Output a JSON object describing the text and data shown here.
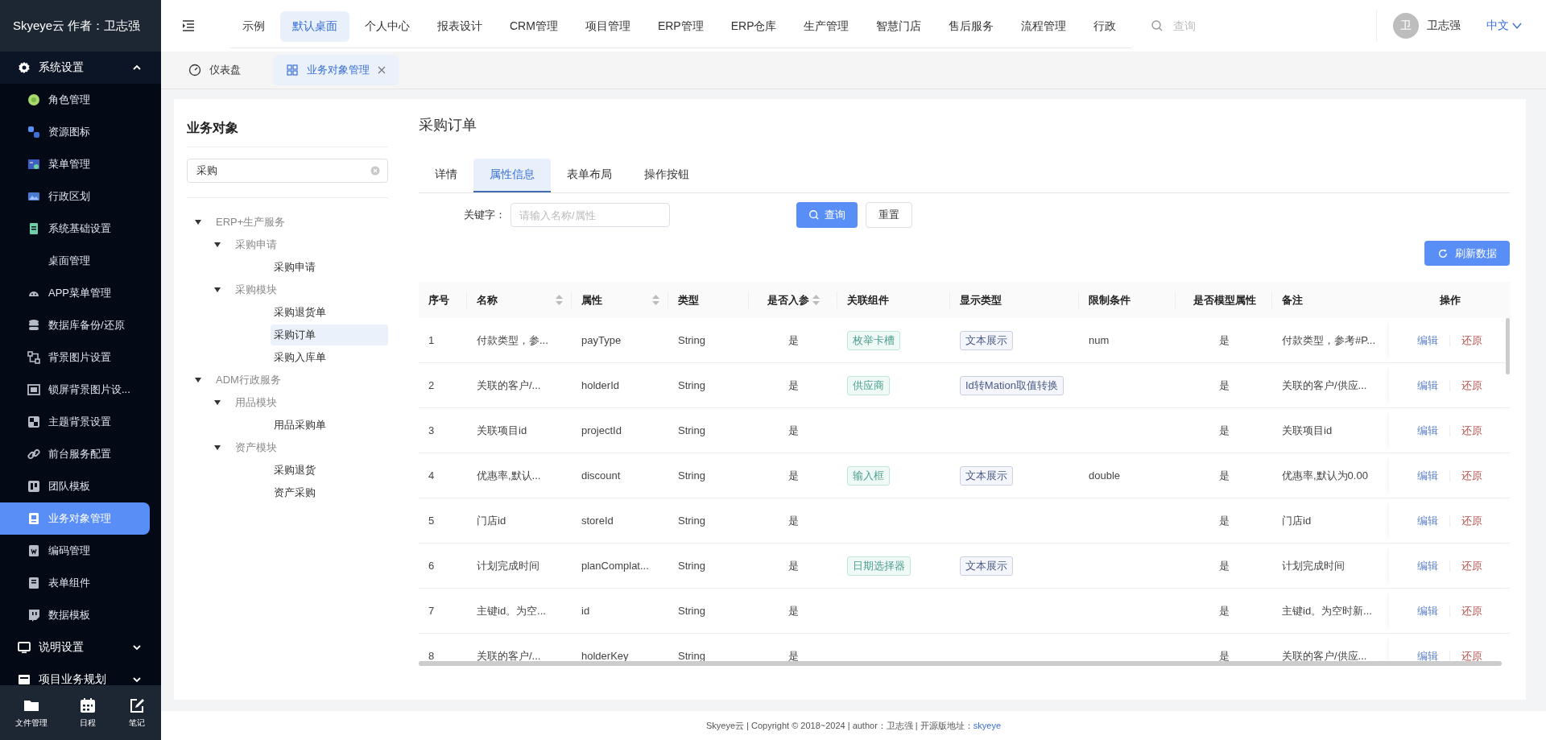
{
  "sidebar": {
    "brand": "Skyeye云 作者：卫志强",
    "groups": [
      {
        "label": "系统设置",
        "expanded": true,
        "items": [
          {
            "label": "角色管理",
            "selected": false
          },
          {
            "label": "资源图标",
            "selected": false
          },
          {
            "label": "菜单管理",
            "selected": false
          },
          {
            "label": "行政区划",
            "selected": false
          },
          {
            "label": "系统基础设置",
            "selected": false
          },
          {
            "label": "桌面管理",
            "selected": false
          },
          {
            "label": "APP菜单管理",
            "selected": false
          },
          {
            "label": "数据库备份/还原",
            "selected": false
          },
          {
            "label": "背景图片设置",
            "selected": false
          },
          {
            "label": "锁屏背景图片设...",
            "selected": false
          },
          {
            "label": "主题背景设置",
            "selected": false
          },
          {
            "label": "前台服务配置",
            "selected": false
          },
          {
            "label": "团队模板",
            "selected": false
          },
          {
            "label": "业务对象管理",
            "selected": true
          },
          {
            "label": "编码管理",
            "selected": false
          },
          {
            "label": "表单组件",
            "selected": false
          },
          {
            "label": "数据模板",
            "selected": false
          }
        ]
      },
      {
        "label": "说明设置",
        "expanded": false
      },
      {
        "label": "项目业务规划",
        "expanded": false
      }
    ],
    "dock": [
      {
        "label": "文件管理"
      },
      {
        "label": "日程"
      },
      {
        "label": "笔记"
      }
    ]
  },
  "top_nav": {
    "items": [
      {
        "label": "示例",
        "selected": false
      },
      {
        "label": "默认桌面",
        "selected": true
      },
      {
        "label": "个人中心",
        "selected": false
      },
      {
        "label": "报表设计",
        "selected": false
      },
      {
        "label": "CRM管理",
        "selected": false
      },
      {
        "label": "项目管理",
        "selected": false
      },
      {
        "label": "ERP管理",
        "selected": false
      },
      {
        "label": "ERP仓库",
        "selected": false
      },
      {
        "label": "生产管理",
        "selected": false
      },
      {
        "label": "智慧门店",
        "selected": false
      },
      {
        "label": "售后服务",
        "selected": false
      },
      {
        "label": "流程管理",
        "selected": false
      },
      {
        "label": "行政",
        "selected": false
      }
    ],
    "search": {
      "placeholder": "查询"
    },
    "user": {
      "avatar": "卫",
      "name": "卫志强"
    },
    "language": "中文"
  },
  "page_tabs": [
    {
      "label": "仪表盘",
      "selected": false,
      "closable": false
    },
    {
      "label": "业务对象管理",
      "selected": true,
      "closable": true
    }
  ],
  "object_tree": {
    "title": "业务对象",
    "search": {
      "value": "采购"
    },
    "nodes": [
      {
        "label": "ERP+生产服务",
        "expanded": true,
        "selected": false,
        "children": [
          {
            "label": "采购申请",
            "expanded": true,
            "selected": false,
            "children": [
              {
                "label": "采购申请",
                "selected": false
              }
            ]
          },
          {
            "label": "采购模块",
            "expanded": true,
            "selected": false,
            "children": [
              {
                "label": "采购退货单",
                "selected": false
              },
              {
                "label": "采购订单",
                "selected": true
              },
              {
                "label": "采购入库单",
                "selected": false
              }
            ]
          }
        ]
      },
      {
        "label": "ADM行政服务",
        "expanded": true,
        "selected": false,
        "children": [
          {
            "label": "用品模块",
            "expanded": true,
            "selected": false,
            "children": [
              {
                "label": "用品采购单",
                "selected": false
              }
            ]
          },
          {
            "label": "资产模块",
            "expanded": true,
            "selected": false,
            "children": [
              {
                "label": "采购退货",
                "selected": false
              },
              {
                "label": "资产采购",
                "selected": false
              }
            ]
          }
        ]
      }
    ]
  },
  "detail": {
    "title": "采购订单",
    "tabs": [
      {
        "label": "详情",
        "selected": false
      },
      {
        "label": "属性信息",
        "selected": true
      },
      {
        "label": "表单布局",
        "selected": false
      },
      {
        "label": "操作按钮",
        "selected": false
      }
    ],
    "filter": {
      "label": "关键字：",
      "placeholder": "请输入名称/属性"
    },
    "buttons": [
      {
        "label": "查询",
        "kind": "primary"
      },
      {
        "label": "重置",
        "kind": "default"
      }
    ],
    "refresh_button": "刷新数据",
    "table": {
      "columns": [
        {
          "label": "序号",
          "sortable": false
        },
        {
          "label": "名称",
          "sortable": true
        },
        {
          "label": "属性",
          "sortable": true
        },
        {
          "label": "类型",
          "sortable": false
        },
        {
          "label": "是否入参",
          "sortable": true
        },
        {
          "label": "关联组件",
          "sortable": false
        },
        {
          "label": "显示类型",
          "sortable": false
        },
        {
          "label": "限制条件",
          "sortable": false
        },
        {
          "label": "是否模型属性",
          "sortable": false
        },
        {
          "label": "备注",
          "sortable": false
        },
        {
          "label": "操作",
          "sortable": false
        }
      ],
      "rows": [
        {
          "index": "1",
          "name": "付款类型，参...",
          "attribute": "payType",
          "type": "String",
          "is_param": "是",
          "component": "枚举卡槽",
          "display_type": "文本展示",
          "constraint": "num",
          "is_model": "是",
          "remark": "付款类型，参考#P...",
          "actions": [
            {
              "label": "编辑",
              "kind": "edit"
            },
            {
              "label": "还原",
              "kind": "restore"
            }
          ]
        },
        {
          "index": "2",
          "name": "关联的客户/...",
          "attribute": "holderId",
          "type": "String",
          "is_param": "是",
          "component": "供应商",
          "display_type": "Id转Mation取值转换",
          "is_model": "是",
          "remark": "关联的客户/供应...",
          "actions": [
            {
              "label": "编辑",
              "kind": "edit"
            },
            {
              "label": "还原",
              "kind": "restore"
            }
          ]
        },
        {
          "index": "3",
          "name": "关联项目id",
          "attribute": "projectId",
          "type": "String",
          "is_param": "是",
          "is_model": "是",
          "remark": "关联项目id",
          "actions": [
            {
              "label": "编辑",
              "kind": "edit"
            },
            {
              "label": "还原",
              "kind": "restore"
            }
          ]
        },
        {
          "index": "4",
          "name": "优惠率,默认...",
          "attribute": "discount",
          "type": "String",
          "is_param": "是",
          "component": "输入框",
          "display_type": "文本展示",
          "constraint": "double",
          "is_model": "是",
          "remark": "优惠率,默认为0.00",
          "actions": [
            {
              "label": "编辑",
              "kind": "edit"
            },
            {
              "label": "还原",
              "kind": "restore"
            }
          ]
        },
        {
          "index": "5",
          "name": "门店id",
          "attribute": "storeId",
          "type": "String",
          "is_param": "是",
          "is_model": "是",
          "remark": "门店id",
          "actions": [
            {
              "label": "编辑",
              "kind": "edit"
            },
            {
              "label": "还原",
              "kind": "restore"
            }
          ]
        },
        {
          "index": "6",
          "name": "计划完成时间",
          "attribute": "planComplat...",
          "type": "String",
          "is_param": "是",
          "component": "日期选择器",
          "display_type": "文本展示",
          "is_model": "是",
          "remark": "计划完成时间",
          "actions": [
            {
              "label": "编辑",
              "kind": "edit"
            },
            {
              "label": "还原",
              "kind": "restore"
            }
          ]
        },
        {
          "index": "7",
          "name": "主键id。为空...",
          "attribute": "id",
          "type": "String",
          "is_param": "是",
          "is_model": "是",
          "remark": "主键id。为空时新...",
          "actions": [
            {
              "label": "编辑",
              "kind": "edit"
            },
            {
              "label": "还原",
              "kind": "restore"
            }
          ]
        },
        {
          "index": "8",
          "name": "关联的客户/...",
          "attribute": "holderKey",
          "type": "String",
          "is_param": "是",
          "is_model": "是",
          "remark": "关联的客户/供应...",
          "actions": [
            {
              "label": "编辑",
              "kind": "edit"
            },
            {
              "label": "还原",
              "kind": "restore"
            }
          ]
        }
      ]
    }
  },
  "footer": {
    "text": "Skyeye云 | Copyright © 2018~2024 | author：卫志强 | 开源版地址：",
    "link": "skyeye"
  }
}
